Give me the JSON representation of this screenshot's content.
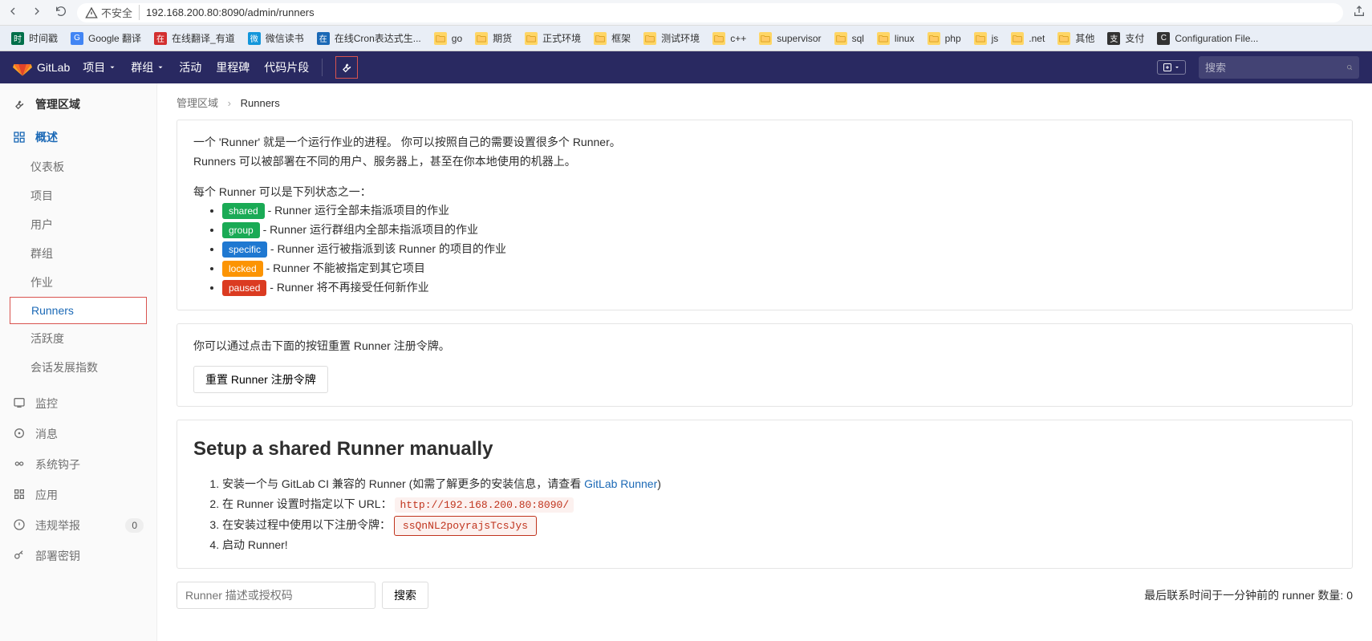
{
  "browser": {
    "insecure_label": "不安全",
    "url": "192.168.200.80:8090/admin/runners"
  },
  "bookmarks": [
    {
      "name": "时间戳",
      "color": "#006f4a"
    },
    {
      "name": "Google 翻译",
      "color": "#4285f4"
    },
    {
      "name": "在线翻译_有道",
      "color": "#d32f2f"
    },
    {
      "name": "微信读书",
      "color": "#1296db"
    },
    {
      "name": "在线Cron表达式生...",
      "color": "#1b69b6"
    },
    {
      "name": "go",
      "folder": true
    },
    {
      "name": "期货",
      "folder": true
    },
    {
      "name": "正式环境",
      "folder": true
    },
    {
      "name": "框架",
      "folder": true
    },
    {
      "name": "测试环境",
      "folder": true
    },
    {
      "name": "c++",
      "folder": true
    },
    {
      "name": "supervisor",
      "folder": true
    },
    {
      "name": "sql",
      "folder": true
    },
    {
      "name": "linux",
      "folder": true
    },
    {
      "name": "php",
      "folder": true
    },
    {
      "name": "js",
      "folder": true
    },
    {
      "name": ".net",
      "folder": true
    },
    {
      "name": "其他",
      "folder": true
    },
    {
      "name": "支付",
      "color": "#333"
    },
    {
      "name": "Configuration File...",
      "color": "#333"
    }
  ],
  "gitlab": {
    "brand": "GitLab",
    "menu": [
      "项目",
      "群组",
      "活动",
      "里程碑",
      "代码片段"
    ],
    "search_placeholder": "搜索"
  },
  "sidebar": {
    "title": "管理区域",
    "overview": "概述",
    "subs": [
      "仪表板",
      "项目",
      "用户",
      "群组",
      "作业",
      "Runners",
      "活跃度",
      "会话发展指数"
    ],
    "items": [
      "监控",
      "消息",
      "系统钩子",
      "应用",
      "违规举报",
      "部署密钥"
    ],
    "violation_count": "0"
  },
  "crumb": {
    "root": "管理区域",
    "leaf": "Runners"
  },
  "intro": {
    "line1": "一个 'Runner' 就是一个运行作业的进程。 你可以按照自己的需要设置很多个 Runner。",
    "line2": "Runners 可以被部署在不同的用户、服务器上，甚至在你本地使用的机器上。",
    "lead": "每个 Runner 可以是下列状态之一：",
    "states": [
      {
        "badge": "shared",
        "cls": "b-shared",
        "desc": " - Runner 运行全部未指派项目的作业"
      },
      {
        "badge": "group",
        "cls": "b-group",
        "desc": " - Runner 运行群组内全部未指派项目的作业"
      },
      {
        "badge": "specific",
        "cls": "b-specific",
        "desc": " - Runner 运行被指派到该 Runner 的项目的作业"
      },
      {
        "badge": "locked",
        "cls": "b-locked",
        "desc": " - Runner 不能被指定到其它项目"
      },
      {
        "badge": "paused",
        "cls": "b-paused",
        "desc": " - Runner 将不再接受任何新作业"
      }
    ]
  },
  "reset": {
    "note": "你可以通过点击下面的按钮重置 Runner 注册令牌。",
    "btn": "重置 Runner 注册令牌"
  },
  "manual": {
    "title": "Setup a shared Runner manually",
    "s1a": "安装一个与 GitLab CI 兼容的 Runner (如需了解更多的安装信息，请查看 ",
    "s1link": "GitLab Runner",
    "s1b": ")",
    "s2": "在 Runner 设置时指定以下 URL： ",
    "url": "http://192.168.200.80:8090/",
    "s3": "在安装过程中使用以下注册令牌： ",
    "token": "ssQnNL2poyrajsTcsJys",
    "s4": "启动 Runner!"
  },
  "searchrow": {
    "placeholder": "Runner 描述或授权码",
    "btn": "搜索",
    "status": "最后联系时间于一分钟前的 runner 数量:  0"
  }
}
